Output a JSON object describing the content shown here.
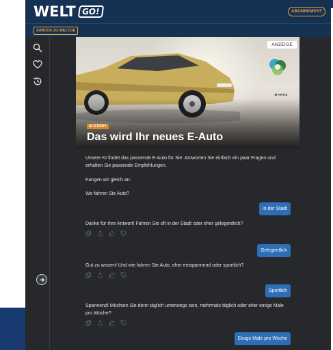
{
  "header": {
    "logo_word": "WELT",
    "logo_badge": "GO!",
    "subscribe_label": "ABONNEMENT"
  },
  "subbar": {
    "back_label": "ZURÜCK ZU WELT.DE"
  },
  "sidebar": {
    "icons": [
      "search-icon",
      "heart-icon",
      "history-icon"
    ],
    "expand_icon": "arrow-right-icon"
  },
  "hero": {
    "ad_label": "ANZEIGE",
    "brand_text": "MARKE",
    "badge": "KI STORY",
    "title": "Das wird Ihr neues E-Auto"
  },
  "chat": {
    "intro": "Unsere KI findet das passende E-Auto für Sie. Antworten Sie einfach ein paar Fragen und erhalten Sie passende Empfehlungen.",
    "start": "Fangen wir gleich an:",
    "q1": "Wo fahren Sie Auto?",
    "a1": "In der Stadt",
    "q2": "Danke für Ihre Antwort! Fahren Sie oft in der Stadt oder eher gelegentlich?",
    "a2": "Gelegentlich",
    "q3": "Gut zu wissen! Und wie fahren Sie Auto, eher entspannend oder sportlich?",
    "a3": "Sportlich",
    "q4": "Spannend! Möchten Sie denn täglich unterwegs sein, mehrmals täglich oder eher einige Male pro Woche?",
    "a4": "Einige Male pro Woche"
  },
  "colors": {
    "header_bg": "#153253",
    "accent_orange": "#f2a33b",
    "reply_blue": "#2d6eb6",
    "app_bg": "#26282b"
  }
}
